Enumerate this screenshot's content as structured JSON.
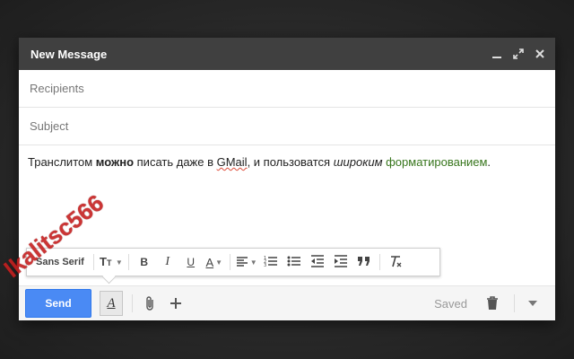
{
  "window": {
    "title": "New Message",
    "controls": [
      "minimize-icon",
      "expand-icon",
      "close-icon"
    ]
  },
  "fields": {
    "recipients_placeholder": "Recipients",
    "subject_placeholder": "Subject"
  },
  "body": {
    "part1": "Транслитом ",
    "bold": "можно",
    "part2": " писать даже в ",
    "spell": "GMail",
    "part3": ", и пользоватся ",
    "italic": "широким",
    "part4": " ",
    "green": "форматированием",
    "part5": "."
  },
  "format_toolbar": {
    "font": "Sans Serif",
    "size_icon": "text-size-icon",
    "bold": "B",
    "italic": "I",
    "underline": "U",
    "text_color": "A",
    "icons": [
      "align-icon",
      "numbered-list-icon",
      "bulleted-list-icon",
      "indent-less-icon",
      "indent-more-icon",
      "quote-icon",
      "remove-formatting-icon"
    ]
  },
  "bottom": {
    "send_label": "Send",
    "format_toggle": "A",
    "saved_label": "Saved"
  },
  "watermark": "lkalitsc566",
  "colors": {
    "titlebar": "#404040",
    "send": "#4a8af4",
    "green_text": "#38761d",
    "watermark": "#c62020"
  }
}
